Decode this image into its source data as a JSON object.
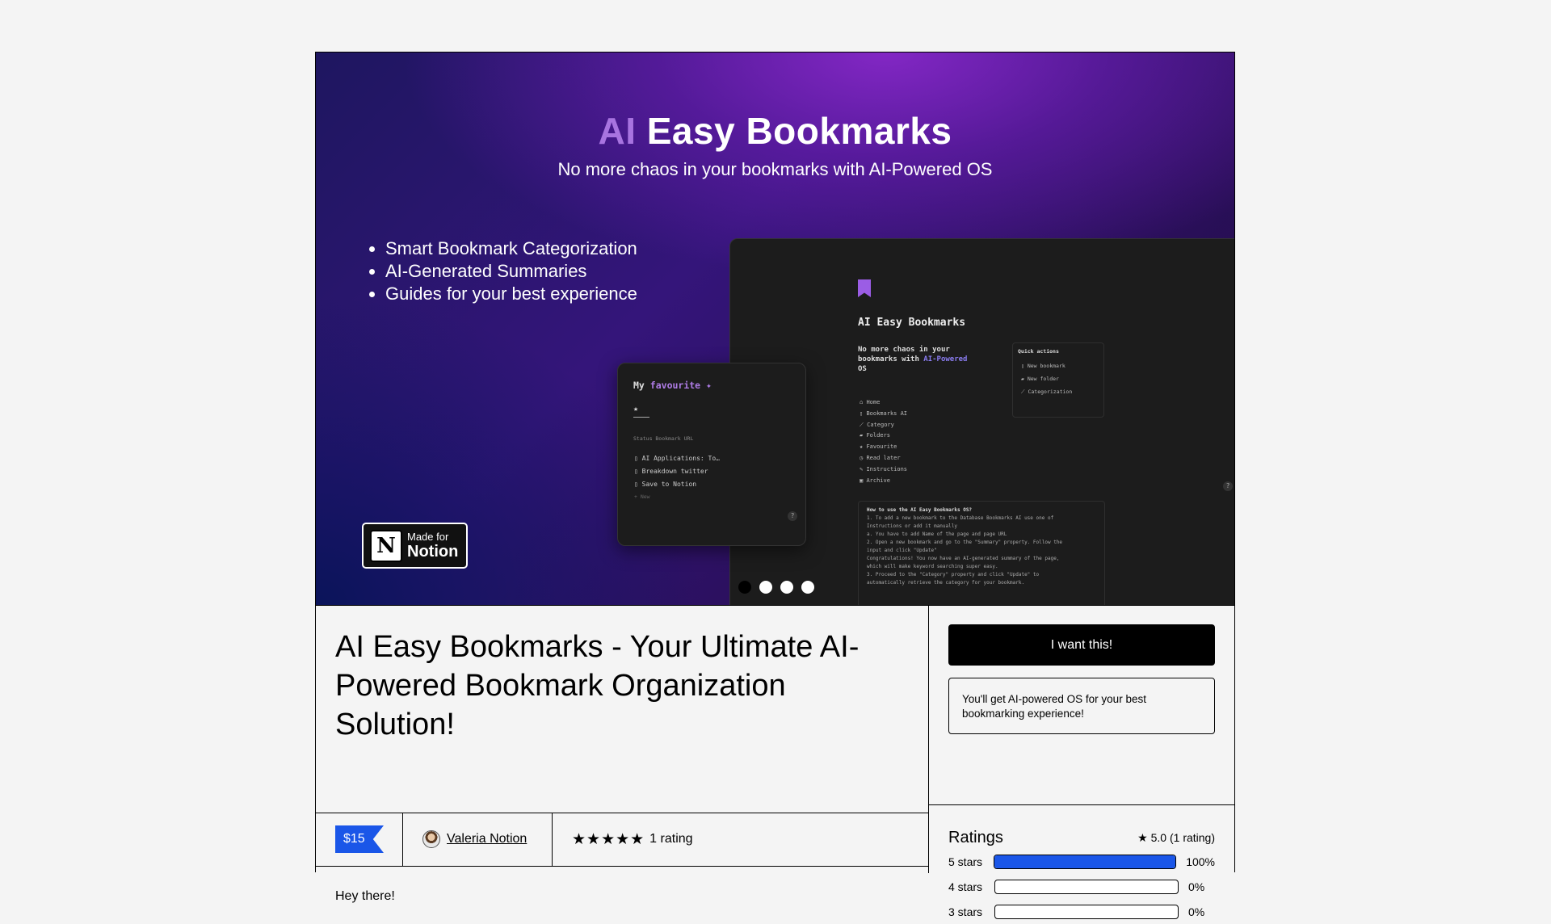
{
  "hero": {
    "title_ai": "AI",
    "title_rest": "Easy Bookmarks",
    "subtitle": "No more chaos in your bookmarks with AI-Powered OS",
    "bullets": [
      "Smart Bookmark Categorization",
      "AI-Generated Summaries",
      "Guides for your best experience"
    ],
    "badge": {
      "line1": "Made for",
      "line2": "Notion"
    },
    "carousel": {
      "count": 4,
      "active_index": 0
    }
  },
  "screenshot_main": {
    "title": "AI Easy Bookmarks",
    "tagline_a": "No more chaos in your bookmarks with",
    "tagline_highlight": "AI-Powered",
    "tagline_b": "OS",
    "nav": [
      "Home",
      "Bookmarks AI",
      "Category",
      "Folders",
      "Favourite",
      "Read later",
      "Instructions",
      "Archive"
    ],
    "quick_actions_title": "Quick actions",
    "quick_actions": [
      "New bookmark",
      "New folder",
      "Categorization"
    ],
    "howto_title": "How to use the AI Easy Bookmarks OS?",
    "howto_lines": [
      "1. To add a new bookmark to the Database Bookmarks AI use one of",
      "   Instructions or add it manually",
      "   a. You have to add Name of the page and page URL",
      "2. Open a new bookmark and go to the \"Summary\" property. Follow the",
      "   input and click \"Update\"",
      "   Congratulations! You now have an AI-generated summary of the page,",
      "   which will make keyword searching super easy.",
      "3. Proceed to the \"Category\" property and click \"Update\" to",
      "   automatically retrieve the category for your bookmark."
    ],
    "help": "?"
  },
  "screenshot_fav": {
    "title_a": "My",
    "title_highlight": "favourite",
    "filters": "Status   Bookmark URL",
    "rows": [
      "AI Applications: To…",
      "Breakdown twitter",
      "Save to Notion"
    ],
    "new_label": "+ New",
    "help": "?"
  },
  "product": {
    "title": "AI Easy Bookmarks - Your Ultimate AI-Powered Bookmark Organization Solution!",
    "price": "$15",
    "author": "Valeria Notion",
    "stars": "★★★★★",
    "rating_count": "1 rating",
    "description_lines": [
      "Hey there!"
    ]
  },
  "buy": {
    "cta_label": "I want this!",
    "summary": "You'll get AI-powered OS for your best bookmarking experience!"
  },
  "ratings": {
    "title": "Ratings",
    "summary": "5.0 (1 rating)",
    "rows": [
      {
        "label": "5 stars",
        "pct_label": "100%",
        "pct": 100
      },
      {
        "label": "4 stars",
        "pct_label": "0%",
        "pct": 0
      },
      {
        "label": "3 stars",
        "pct_label": "0%",
        "pct": 0
      }
    ]
  },
  "colors": {
    "accent_blue": "#1a56e8",
    "ai_purple": "#a874e0",
    "page_bg": "#f4f4f4"
  }
}
